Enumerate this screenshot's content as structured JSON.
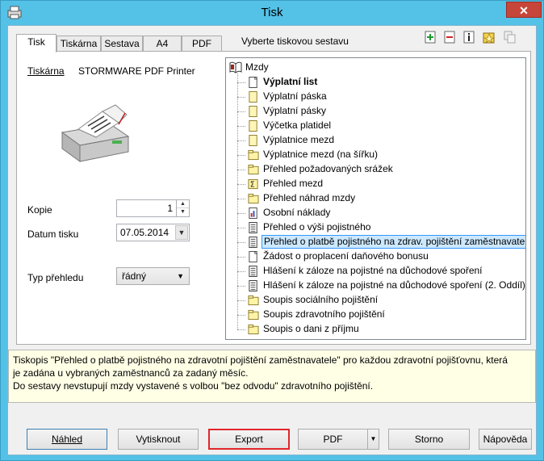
{
  "window": {
    "title": "Tisk",
    "close_glyph": "✕"
  },
  "tabs": [
    {
      "label": "Tisk",
      "active": true
    },
    {
      "label": "Tiskárna"
    },
    {
      "label": "Sestava"
    },
    {
      "label": "A4"
    },
    {
      "label": "PDF"
    }
  ],
  "tabs_title": "Vyberte tiskovou sestavu",
  "toolbar_icons": [
    "add-icon",
    "remove-icon",
    "info-icon",
    "favorite-icon",
    "copy-icon"
  ],
  "printer": {
    "label": "Tiskárna",
    "name": "STORMWARE PDF Printer"
  },
  "form": {
    "copies_label": "Kopie",
    "copies_value": "1",
    "date_label": "Datum tisku",
    "date_value": "07.05.2014",
    "type_label": "Typ přehledu",
    "type_value": "řádný"
  },
  "tree": {
    "root": "Mzdy",
    "items": [
      {
        "label": "Výplatní list",
        "icon": "page-icon",
        "bold": true
      },
      {
        "label": "Výplatní páska",
        "icon": "yellow-page-icon"
      },
      {
        "label": "Výplatní pásky",
        "icon": "yellow-page-icon"
      },
      {
        "label": "Výčetka platidel",
        "icon": "yellow-page-icon"
      },
      {
        "label": "Výplatnice mezd",
        "icon": "yellow-page-icon"
      },
      {
        "label": "Výplatnice mezd (na šířku)",
        "icon": "yellow-folder-icon"
      },
      {
        "label": "Přehled požadovaných srážek",
        "icon": "yellow-folder-icon"
      },
      {
        "label": "Přehled mezd",
        "icon": "sum-icon"
      },
      {
        "label": "Přehled náhrad mzdy",
        "icon": "yellow-folder-icon"
      },
      {
        "label": "Osobní náklady",
        "icon": "chart-icon"
      },
      {
        "label": "Přehled o výši pojistného",
        "icon": "document-icon"
      },
      {
        "label": "Přehled o platbě pojistného na zdrav. pojištění zaměstnavatele",
        "icon": "document-icon",
        "selected": true
      },
      {
        "label": "Žádost o proplacení daňového bonusu",
        "icon": "page-icon"
      },
      {
        "label": "Hlášení k záloze na pojistné na důchodové spoření",
        "icon": "document-icon"
      },
      {
        "label": "Hlášení k záloze na pojistné na důchodové spoření (2. Oddíl)",
        "icon": "document-icon"
      },
      {
        "label": "Soupis sociálního pojištění",
        "icon": "yellow-folder-icon"
      },
      {
        "label": "Soupis zdravotního pojištění",
        "icon": "yellow-folder-icon"
      },
      {
        "label": "Soupis o dani z příjmu",
        "icon": "yellow-folder-icon"
      }
    ]
  },
  "description": [
    "Tiskopis \"Přehled o platbě pojistného na zdravotní pojištění zaměstnavatele\" pro každou zdravotní pojišťovnu, která",
    "je zadána u vybraných zaměstnanců za zadaný měsíc.",
    "Do sestavy nevstupují mzdy vystavené s volbou \"bez odvodu\" zdravotního pojištění."
  ],
  "buttons": {
    "preview": "Náhled",
    "print": "Vytisknout",
    "export": "Export",
    "pdf": "PDF",
    "cancel": "Storno",
    "help": "Nápověda"
  },
  "colors": {
    "selection": "#cce8ff",
    "export_border": "#e0262b",
    "desc_bg": "#ffffe6"
  }
}
